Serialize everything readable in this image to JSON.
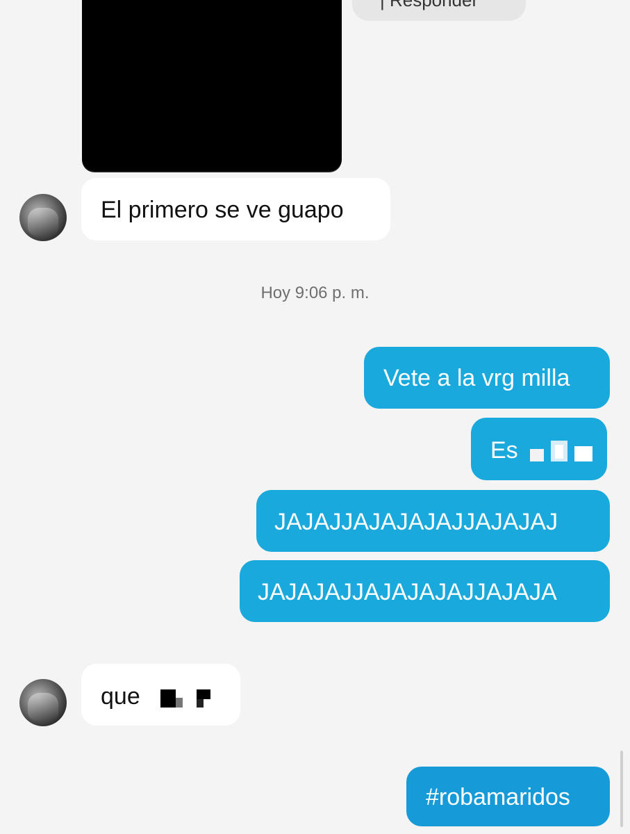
{
  "conversation": {
    "reply_label": "| Responder",
    "msg1": "El primero se ve guapo",
    "timestamp": "Hoy 9:06 p. m.",
    "out1": "Vete a la vrg milla",
    "out2": "Es",
    "out3": "JAJAJJAJAJAJAJJAJAJAJ",
    "out4": "JAJAJAJJAJAJAJAJJAJAJA",
    "msg2": "que",
    "out5": "#robamaridos"
  },
  "colors": {
    "background": "#f4f4f4",
    "incoming_bubble": "#ffffff",
    "outgoing_bubble": "#1aa9dc",
    "timestamp_text": "#6f6f6f"
  },
  "icons": {
    "avatar": "user-avatar"
  }
}
